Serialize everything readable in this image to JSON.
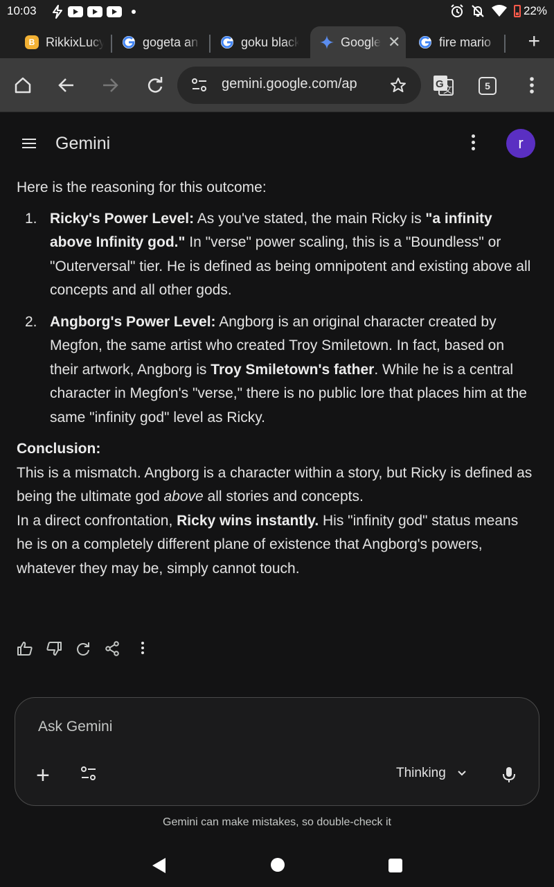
{
  "status_bar": {
    "time": "10:03",
    "battery": "22%"
  },
  "tabs": [
    {
      "label": "RikkixLucy",
      "favicon": "rikkix-icon",
      "active": false
    },
    {
      "label": "gogeta an",
      "favicon": "google-icon",
      "active": false
    },
    {
      "label": "goku black",
      "favicon": "google-icon",
      "active": false
    },
    {
      "label": "Google",
      "favicon": "gemini-icon",
      "active": true
    },
    {
      "label": "fire mario",
      "favicon": "google-icon",
      "active": false
    }
  ],
  "toolbar": {
    "url": "gemini.google.com/ap",
    "tab_count": "5"
  },
  "app": {
    "title": "Gemini",
    "avatar_letter": "r",
    "avatar_color": "#5a2fc2"
  },
  "response": {
    "intro": "Here is the reasoning for this outcome:",
    "items": [
      {
        "num": "1.",
        "title": "Ricky's Power Level:",
        "t1": " As you've stated, the main Ricky is ",
        "b1": "\"a infinity above Infinity god.\"",
        "t2": " In \"verse\" power scaling, this is a \"Boundless\" or \"Outerversal\" tier. He is defined as being omnipotent and existing above all concepts and all other gods."
      },
      {
        "num": "2.",
        "title": "Angborg's Power Level:",
        "t1": " Angborg is an original character created by Megfon, the same artist who created Troy Smiletown. In fact, based on their artwork, Angborg is ",
        "b1": "Troy Smiletown's father",
        "t2": ". While he is a central character in Megfon's \"verse,\" there is no public lore that places him at the same \"infinity god\" level as Ricky."
      }
    ],
    "conclusion_heading": "Conclusion:",
    "para1_a": "This is a mismatch. Angborg is a character within a story, but Ricky is defined as being the ultimate god ",
    "para1_em": "above",
    "para1_b": " all stories and concepts.",
    "para2_a": "In a direct confrontation, ",
    "para2_bold": "Ricky wins instantly.",
    "para2_b": " His \"infinity god\" status means he is on a completely different plane of existence that Angborg's powers, whatever they may be, simply cannot touch."
  },
  "input": {
    "placeholder": "Ask Gemini",
    "mode_label": "Thinking"
  },
  "disclaimer": "Gemini can make mistakes, so double-check it"
}
